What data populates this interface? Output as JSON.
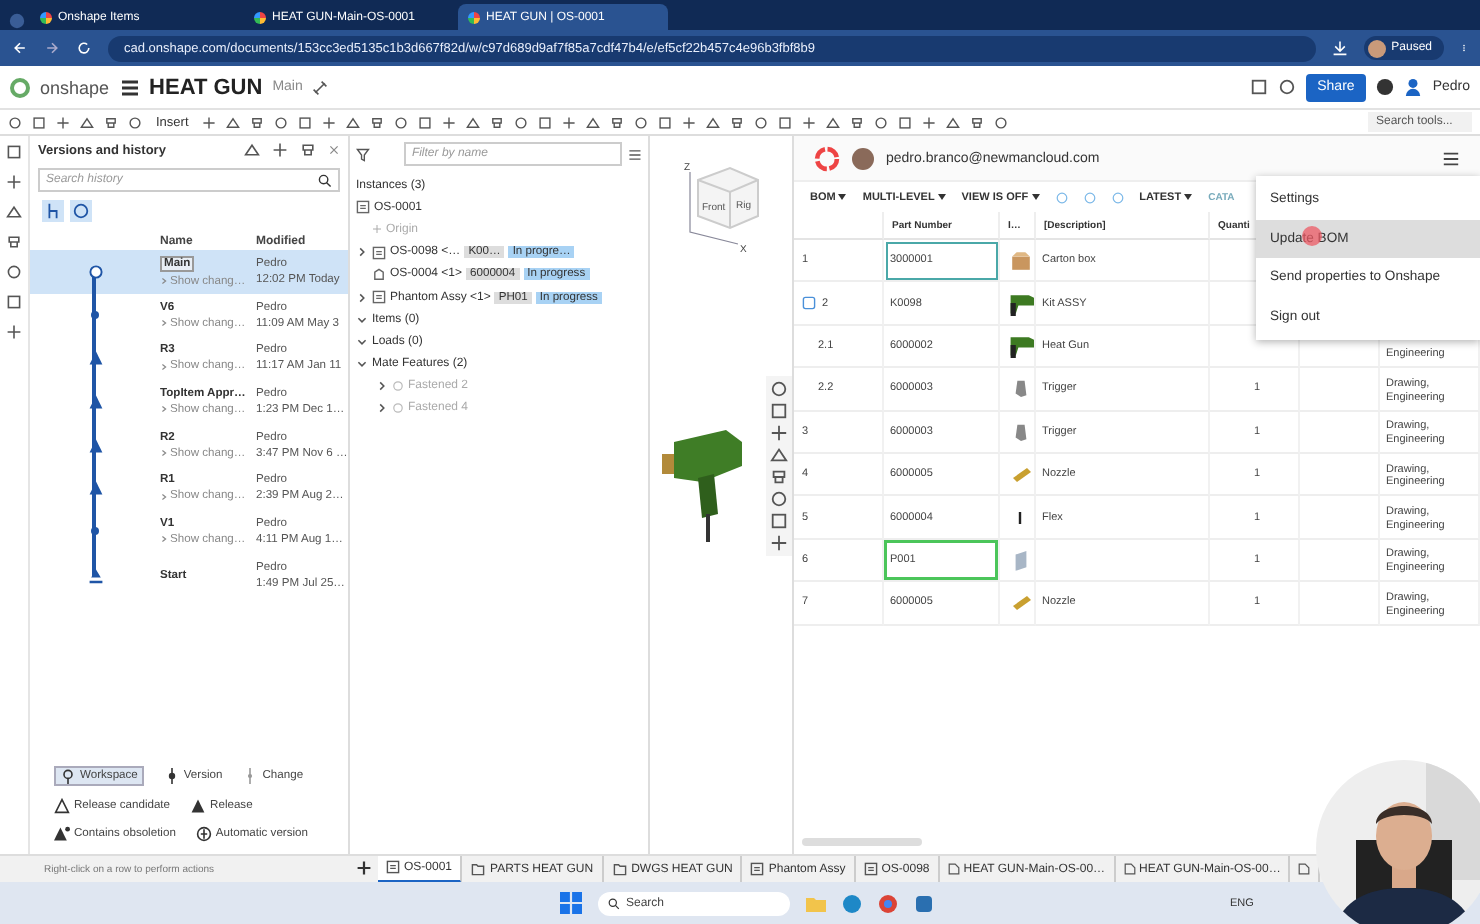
{
  "browser": {
    "tabs": [
      {
        "title": "Onshape Items",
        "selected": false
      },
      {
        "title": "HEAT GUN-Main-OS-0001",
        "selected": false
      },
      {
        "title": "HEAT GUN | OS-0001",
        "selected": true
      }
    ],
    "url": "cad.onshape.com/documents/153cc3ed5135c1b3d667f82d/w/c97d689d9af7f85a7cdf47b4/e/ef5cf22b457c4e96b3fbf8b9",
    "profile": "Paused"
  },
  "header": {
    "logo": "onshape",
    "document": "HEAT GUN",
    "branch": "Main",
    "share": "Share",
    "user": "Pedro"
  },
  "toolbar": {
    "insert": "Insert",
    "search_placeholder": "Search tools..."
  },
  "versions": {
    "title": "Versions and history",
    "search_placeholder": "Search history",
    "columns": [
      "Name",
      "Modified"
    ],
    "rows": [
      {
        "name": "Main",
        "kind": "workspace",
        "changes": "Show chang…",
        "author": "Pedro",
        "time": "12:02 PM Today",
        "selected": true
      },
      {
        "name": "V6",
        "kind": "version",
        "changes": "Show chang…",
        "author": "Pedro",
        "time": "11:09 AM May 3",
        "selected": false
      },
      {
        "name": "R3",
        "kind": "release",
        "changes": "Show chang…",
        "author": "Pedro",
        "time": "11:17 AM Jan 11",
        "selected": false
      },
      {
        "name": "TopItem Appr…",
        "kind": "release",
        "changes": "Show chang…",
        "author": "Pedro",
        "time": "1:23 PM Dec 1…",
        "selected": false
      },
      {
        "name": "R2",
        "kind": "release",
        "changes": "Show chang…",
        "author": "Pedro",
        "time": "3:47 PM Nov 6 …",
        "selected": false
      },
      {
        "name": "R1",
        "kind": "release",
        "changes": "Show chang…",
        "author": "Pedro",
        "time": "2:39 PM Aug 2…",
        "selected": false
      },
      {
        "name": "V1",
        "kind": "version",
        "changes": "Show chang…",
        "author": "Pedro",
        "time": "4:11 PM Aug 1…",
        "selected": false
      },
      {
        "name": "Start",
        "kind": "start",
        "author": "Pedro",
        "time": "1:49 PM Jul 25…",
        "selected": false
      }
    ],
    "legend": [
      {
        "label": "Workspace",
        "kind": "workspace",
        "selected": true
      },
      {
        "label": "Version",
        "kind": "version",
        "selected": false
      },
      {
        "label": "Change",
        "kind": "change",
        "selected": false
      },
      {
        "label": "Release candidate",
        "kind": "candidate",
        "selected": false
      },
      {
        "label": "Release",
        "kind": "release",
        "selected": false
      },
      {
        "label": "Contains obsoletion",
        "kind": "obsoletion",
        "selected": false
      },
      {
        "label": "Automatic version",
        "kind": "automatic",
        "selected": false
      }
    ],
    "hint": "Right-click on a row to perform actions"
  },
  "feature_tree": {
    "filter_placeholder": "Filter by name",
    "nodes": [
      {
        "label": "Instances (3)",
        "kind": "heading"
      },
      {
        "label": "OS-0001",
        "kind": "assembly"
      },
      {
        "label": "Origin",
        "kind": "origin"
      },
      {
        "label": "OS-0098 <…",
        "kind": "subassembly",
        "expanded": false,
        "part_number": "K00…",
        "status": "In progre…"
      },
      {
        "label": "OS-0004 <1>",
        "kind": "part",
        "part_number": "6000004",
        "status": "In progress"
      },
      {
        "label": "Phantom Assy <1>",
        "kind": "assembly",
        "expanded": false,
        "part_number": "PH01",
        "status": "In progress"
      },
      {
        "label": "Items (0)",
        "kind": "folder",
        "expanded": true
      },
      {
        "label": "Loads (0)",
        "kind": "folder",
        "expanded": true
      },
      {
        "label": "Mate Features (2)",
        "kind": "folder",
        "expanded": true,
        "children": [
          {
            "label": "Fastened 2",
            "kind": "mate",
            "expanded": false
          },
          {
            "label": "Fastened 4",
            "kind": "mate",
            "expanded": false
          }
        ]
      }
    ]
  },
  "viewcube": {
    "faces": [
      "Front",
      "Rig"
    ],
    "axes": [
      "Z",
      "X"
    ]
  },
  "bom": {
    "user": "pedro.branco@newmancloud.com",
    "toolbar": [
      "BOM",
      "MULTI-LEVEL",
      "VIEW IS OFF"
    ],
    "version": "LATEST",
    "cut_label": "CATA",
    "columns": [
      "Part Number",
      "I…",
      "[Description]",
      "Quanti"
    ],
    "rows": [
      {
        "index": "1",
        "part": "3000001",
        "kind": "box",
        "description": "Carton box",
        "selected": true,
        "modified": false
      },
      {
        "index": "2",
        "part": "K0098",
        "kind": "gun",
        "description": "Kit ASSY",
        "selected": false,
        "modified": false,
        "children": [
          {
            "index": "2.1",
            "part": "6000002",
            "kind": "gun",
            "description": "Heat Gun",
            "category": "Engineering",
            "selected": false,
            "modified": false
          },
          {
            "index": "2.2",
            "part": "6000003",
            "kind": "trigger",
            "description": "Trigger",
            "quantity": "1",
            "category": "Drawing, Engineering",
            "selected": false,
            "modified": false
          }
        ]
      },
      {
        "index": "3",
        "part": "6000003",
        "kind": "trigger",
        "description": "Trigger",
        "quantity": "1",
        "category": "Drawing, Engineering",
        "selected": false,
        "modified": false
      },
      {
        "index": "4",
        "part": "6000005",
        "kind": "nozzle",
        "description": "Nozzle",
        "quantity": "1",
        "category": "Drawing, Engineering",
        "selected": false,
        "modified": false
      },
      {
        "index": "5",
        "part": "6000004",
        "kind": "flex",
        "description": "Flex",
        "quantity": "1",
        "category": "Drawing, Engineering",
        "selected": false,
        "modified": false
      },
      {
        "index": "6",
        "part": "P001",
        "kind": "plate",
        "quantity": "1",
        "category": "Drawing, Engineering",
        "selected": false,
        "modified": true
      },
      {
        "index": "7",
        "part": "6000005",
        "kind": "nozzle",
        "description": "Nozzle",
        "quantity": "1",
        "category": "Drawing, Engineering",
        "selected": false,
        "modified": false
      }
    ],
    "menu": [
      {
        "label": "Settings",
        "selected": false
      },
      {
        "label": "Update BOM",
        "selected": true
      },
      {
        "label": "Send properties to Onshape",
        "selected": false
      },
      {
        "label": "Sign out",
        "selected": false
      }
    ]
  },
  "bottom_tabs": [
    {
      "label": "OS-0001",
      "kind": "assembly",
      "selected": true
    },
    {
      "label": "PARTS HEAT GUN",
      "kind": "folder",
      "selected": false
    },
    {
      "label": "DWGS HEAT GUN",
      "kind": "folder",
      "selected": false
    },
    {
      "label": "Phantom Assy",
      "kind": "assembly",
      "selected": false
    },
    {
      "label": "OS-0098",
      "kind": "assembly",
      "selected": false
    },
    {
      "label": "HEAT GUN-Main-OS-00…",
      "kind": "drawing",
      "selected": false
    },
    {
      "label": "HEAT GUN-Main-OS-00…",
      "kind": "drawing",
      "selected": false
    },
    {
      "kind": "drawing",
      "selected": false
    }
  ],
  "taskbar": {
    "search": "Search",
    "language": "ENG"
  }
}
